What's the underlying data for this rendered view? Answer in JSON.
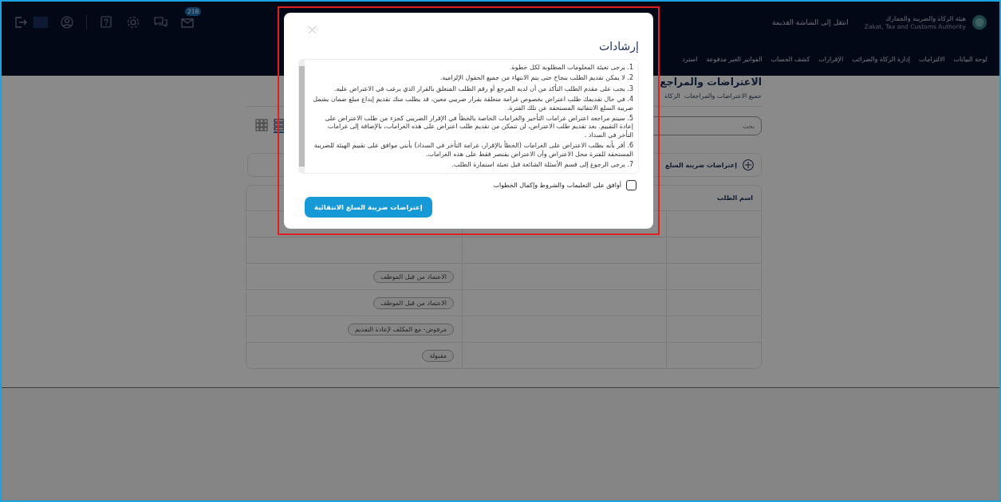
{
  "header": {
    "logo": {
      "name_ar": "هيئة الزكاة والضريبة والجمارك",
      "name_en": "Zakat, Tax and Customs Authority"
    },
    "old_screen_link": "انتقل إلى الشاشة القديمة",
    "mail_badge": "218",
    "nav": [
      "لوحة البيانات",
      "الالتزامات",
      "إدارة الزكاة والضرائب",
      "الإقرارات",
      "كشف الحساب",
      "الفواتير الغير مدفوعة",
      "استرد"
    ]
  },
  "page": {
    "title": "الاعتراضات والمراجع",
    "breadcrumb": [
      "جميع الاعتراضات والمراجعات",
      "الزكاة"
    ],
    "search": {
      "placeholder": "بحث"
    },
    "view_toggle": [
      {
        "kind": "grid",
        "selected": false
      },
      {
        "kind": "list",
        "selected": true
      }
    ],
    "new_request": "إعتراضات ضريبة السلع",
    "table": {
      "columns": [
        "اسم الطلب"
      ],
      "rows": [
        {
          "status": "الاعتماد من قبل الموظف"
        },
        {
          "status": "الاعتماد من قبل الموظف"
        },
        {
          "status": "مرفوض- مع المكلف لإعادة التقديم"
        },
        {
          "status": "مقبولة"
        }
      ]
    }
  },
  "modal": {
    "title": "إرشادات",
    "instructions": [
      "1. يرجى تعبئة المعلومات المطلوبة لكل خطوة.",
      "2. لا يمكن تقديم الطلب بنجاح حتى يتم الانتهاء من جميع الحقول الإلزامية.",
      "3. يجب على مقدم الطلب التأكد من أن لديه المرجع أو رقم الطلب المتعلق بالقرار الذي يرغب في الاعتراض عليه.",
      "4. في حال تقديمك طلب اعتراض بخصوص غرامة متعلقة بقرار ضريبي معين، قد يطلب منك تقديم إيداع مبلغ ضمان يشمل ضريبة السلع الانتقائية المستحقة عن تلك الفترة.",
      "5. سيتم مراجعة اعتراض غرامات التأخير والغرامات الخاصة بالخطأ في الإقرار الضريبي كجزء من طلب الاعتراض على إعادة التقييم. بعد تقديم طلب الاعتراض، لن تتمكن من تقديم طلب اعتراض على هذه الغرامات، بالإضافة إلى غرامات التأخر في السداد .",
      "6. أقر بأنه بطلب الاعتراض على الغرامات (الخطأ بالإقرار، غرامة التأخر في السداد) بأنني موافق على تقييم الهيئة للضريبة المستحقة للفترة محل الاعتراض وأن الاعتراض يقتصر فقط على هذه الغرامات.",
      "7. يرجى الرجوع إلى قسم الأسئلة الشائعة قبل تعبئة استمارة الطلب."
    ],
    "agree": {
      "label": "أوافق على التعليمات والشروط وإكمال الخطوات",
      "checked": false
    },
    "button": "إعتراضات ضريبة السلع الانتقائية"
  }
}
